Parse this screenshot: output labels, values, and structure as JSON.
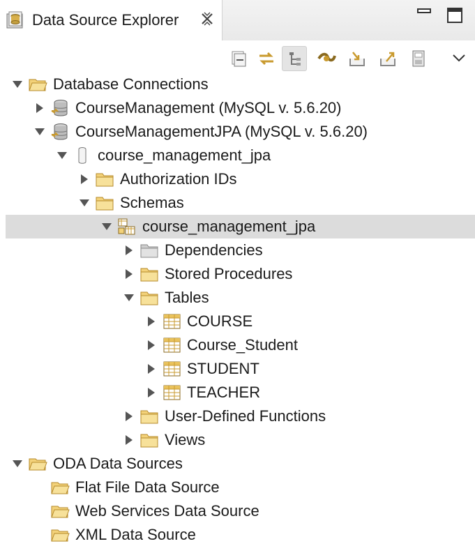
{
  "view": {
    "tab_title": "Data Source Explorer"
  },
  "tree": {
    "database_connections": "Database Connections",
    "conn_course_management": "CourseManagement (MySQL v. 5.6.20)",
    "conn_course_management_jpa": "CourseManagementJPA (MySQL v. 5.6.20)",
    "db_course_management_jpa": "course_management_jpa",
    "authorization_ids": "Authorization IDs",
    "schemas": "Schemas",
    "schema_course_management_jpa": "course_management_jpa",
    "dependencies": "Dependencies",
    "stored_procedures": "Stored Procedures",
    "tables": "Tables",
    "table_course": "COURSE",
    "table_course_student": "Course_Student",
    "table_student": "STUDENT",
    "table_teacher": "TEACHER",
    "user_defined_functions": "User-Defined Functions",
    "views": "Views",
    "oda_data_sources": "ODA Data Sources",
    "flat_file": "Flat File Data Source",
    "web_services": "Web Services Data Source",
    "xml": "XML Data Source"
  },
  "icons": {
    "tab": "data-source-explorer-icon",
    "close": "close-icon",
    "folder": "folder-icon",
    "connection": "database-connection-icon",
    "database": "database-icon",
    "schema": "schema-icon",
    "table": "table-icon"
  },
  "colors": {
    "selection": "#dcdcdc",
    "folder_fill": "#f3d27a",
    "folder_stroke": "#b68a2a"
  }
}
